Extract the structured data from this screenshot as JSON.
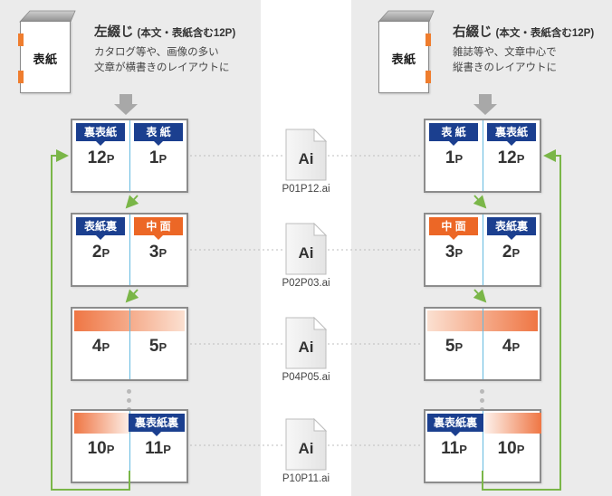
{
  "page": {
    "background_color": "#ebebeb",
    "center_band_color": "#ffffff"
  },
  "colors": {
    "blue_tag": "#1b3f8f",
    "orange_tag": "#ec6726",
    "green_flow": "#7ab648",
    "gutter_blue": "#63b9e0",
    "staple_orange": "#ef7d2e",
    "gradient_orange": "#ef7644"
  },
  "left_section": {
    "book": {
      "cover_label": "表紙",
      "binding_edge": "left"
    },
    "title_main": "左綴じ",
    "title_sub": "(本文・表紙含む12P)",
    "desc_line1": "カタログ等や、画像の多い",
    "desc_line2": "文章が横書きのレイアウトに",
    "spreads": [
      {
        "left": {
          "tag": "裏表紙",
          "tag_color": "blue",
          "page": "12",
          "unit": "P"
        },
        "right": {
          "tag": "表 紙",
          "tag_color": "blue",
          "page": "1",
          "unit": "P"
        }
      },
      {
        "left": {
          "tag": "表紙裏",
          "tag_color": "blue",
          "page": "2",
          "unit": "P"
        },
        "right": {
          "tag": "中 面",
          "tag_color": "orange",
          "page": "3",
          "unit": "P"
        }
      },
      {
        "left": {
          "tag": null,
          "tag_color": null,
          "page": "4",
          "unit": "P"
        },
        "right": {
          "tag": null,
          "tag_color": null,
          "page": "5",
          "unit": "P"
        },
        "gradient": "full-left-to-right"
      },
      {
        "left": {
          "tag": null,
          "tag_color": null,
          "page": "10",
          "unit": "P"
        },
        "right": {
          "tag": "裏表紙裏",
          "tag_color": "blue",
          "page": "11",
          "unit": "P"
        },
        "gradient": "half-left"
      }
    ]
  },
  "right_section": {
    "book": {
      "cover_label": "表紙",
      "binding_edge": "right"
    },
    "title_main": "右綴じ",
    "title_sub": "(本文・表紙含む12P)",
    "desc_line1": "雑誌等や、文章中心で",
    "desc_line2": "縦書きのレイアウトに",
    "spreads": [
      {
        "left": {
          "tag": "表 紙",
          "tag_color": "blue",
          "page": "1",
          "unit": "P"
        },
        "right": {
          "tag": "裏表紙",
          "tag_color": "blue",
          "page": "12",
          "unit": "P"
        }
      },
      {
        "left": {
          "tag": "中 面",
          "tag_color": "orange",
          "page": "3",
          "unit": "P"
        },
        "right": {
          "tag": "表紙裏",
          "tag_color": "blue",
          "page": "2",
          "unit": "P"
        }
      },
      {
        "left": {
          "tag": null,
          "tag_color": null,
          "page": "5",
          "unit": "P"
        },
        "right": {
          "tag": null,
          "tag_color": null,
          "page": "4",
          "unit": "P"
        },
        "gradient": "full-right-to-left"
      },
      {
        "left": {
          "tag": "裏表紙裏",
          "tag_color": "blue",
          "page": "11",
          "unit": "P"
        },
        "right": {
          "tag": null,
          "tag_color": null,
          "page": "10",
          "unit": "P"
        },
        "gradient": "half-right"
      }
    ]
  },
  "files": [
    {
      "icon_label": "Ai",
      "name": "P01P12.ai"
    },
    {
      "icon_label": "Ai",
      "name": "P02P03.ai"
    },
    {
      "icon_label": "Ai",
      "name": "P04P05.ai"
    },
    {
      "icon_label": "Ai",
      "name": "P10P11.ai"
    }
  ]
}
